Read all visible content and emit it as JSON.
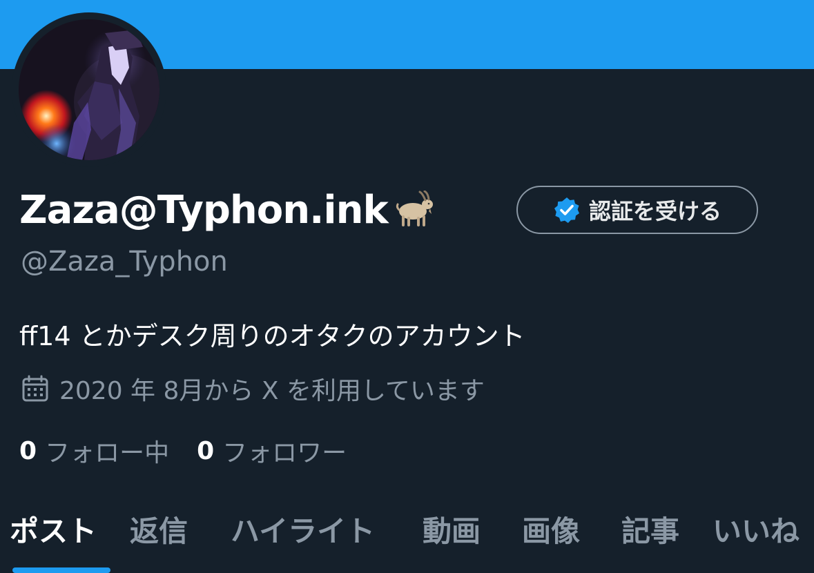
{
  "profile": {
    "display_name": "Zaza@Typhon.ink",
    "name_emoji_icon": "goat-icon",
    "handle": "@Zaza_Typhon",
    "bio": "ff14 とかデスク周りのオタクのアカウント",
    "joined": "2020 年 8月から X を利用しています"
  },
  "verify_button": {
    "label": "認証を受ける",
    "icon": "verified-badge-icon"
  },
  "stats": {
    "following_count": "0",
    "following_label": "フォロー中",
    "followers_count": "0",
    "followers_label": "フォロワー"
  },
  "tabs": [
    {
      "label": "ポスト",
      "active": true
    },
    {
      "label": "返信"
    },
    {
      "label": "ハイライト"
    },
    {
      "label": "動画"
    },
    {
      "label": "画像"
    },
    {
      "label": "記事"
    },
    {
      "label": "いいね"
    }
  ],
  "colors": {
    "background": "#15202b",
    "banner": "#1d9bf0",
    "accent": "#1d9bf0",
    "text_primary": "#ffffff",
    "text_secondary": "#8b98a5"
  }
}
